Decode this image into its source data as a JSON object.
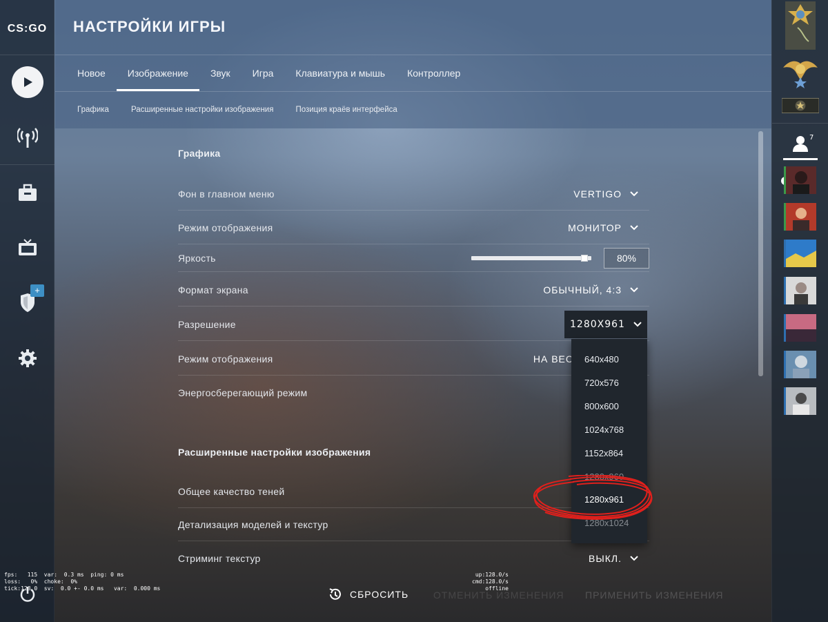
{
  "app": {
    "logo_text": "CS:GO"
  },
  "header": {
    "title": "НАСТРОЙКИ ИГРЫ"
  },
  "tabs": [
    {
      "label": "Новое"
    },
    {
      "label": "Изображение"
    },
    {
      "label": "Звук"
    },
    {
      "label": "Игра"
    },
    {
      "label": "Клавиатура и мышь"
    },
    {
      "label": "Контроллер"
    }
  ],
  "subtabs": [
    {
      "label": "Графика"
    },
    {
      "label": "Расширенные настройки изображения"
    },
    {
      "label": "Позиция краёв интерфейса"
    }
  ],
  "sections": {
    "graphics": "Графика",
    "advanced": "Расширенные настройки изображения"
  },
  "settings": {
    "menu_background": {
      "label": "Фон в главном меню",
      "value": "VERTIGO"
    },
    "display_mode": {
      "label": "Режим отображения",
      "value": "МОНИТОР"
    },
    "brightness": {
      "label": "Яркость",
      "value": "80%",
      "level": 0.97
    },
    "aspect_ratio": {
      "label": "Формат экрана",
      "value": "ОБЫЧНЫЙ, 4:3"
    },
    "resolution": {
      "label": "Разрешение",
      "value": "1280X961"
    },
    "display_mode2": {
      "label": "Режим отображения",
      "value": "НА ВЕС"
    },
    "power_saving": {
      "label": "Энергосберегающий режим"
    },
    "shadow_quality": {
      "label": "Общее качество теней"
    },
    "model_detail": {
      "label": "Детализация моделей и текстур"
    },
    "texture_streaming": {
      "label": "Стриминг текстур",
      "value": "ВЫКЛ."
    }
  },
  "resolution_options": [
    "640x480",
    "720x576",
    "800x600",
    "1024x768",
    "1152x864",
    "1280x960",
    "1280x961",
    "1280x1024"
  ],
  "selected_resolution": "1280x961",
  "bottom": {
    "reset_label": "СБРОСИТЬ",
    "cancel_label": "ОТМЕНИТЬ ИЗМЕНЕНИЯ",
    "apply_label": "ПРИМЕНИТЬ ИЗМЕНЕНИЯ"
  },
  "netgraph": {
    "left": "fps:   115  var:  0.3 ms  ping: 0 ms\nloss:   0%  choke:  0%\ntick:128.0  sv:  0.0 +- 0.0 ms   var:  0.000 ms",
    "right": "up:128.0/s\ncmd:128.0/s\noffline"
  },
  "friends": {
    "count": "7"
  },
  "colors": {
    "accent": "#3d8fc4",
    "online": "#3b9a4a"
  }
}
